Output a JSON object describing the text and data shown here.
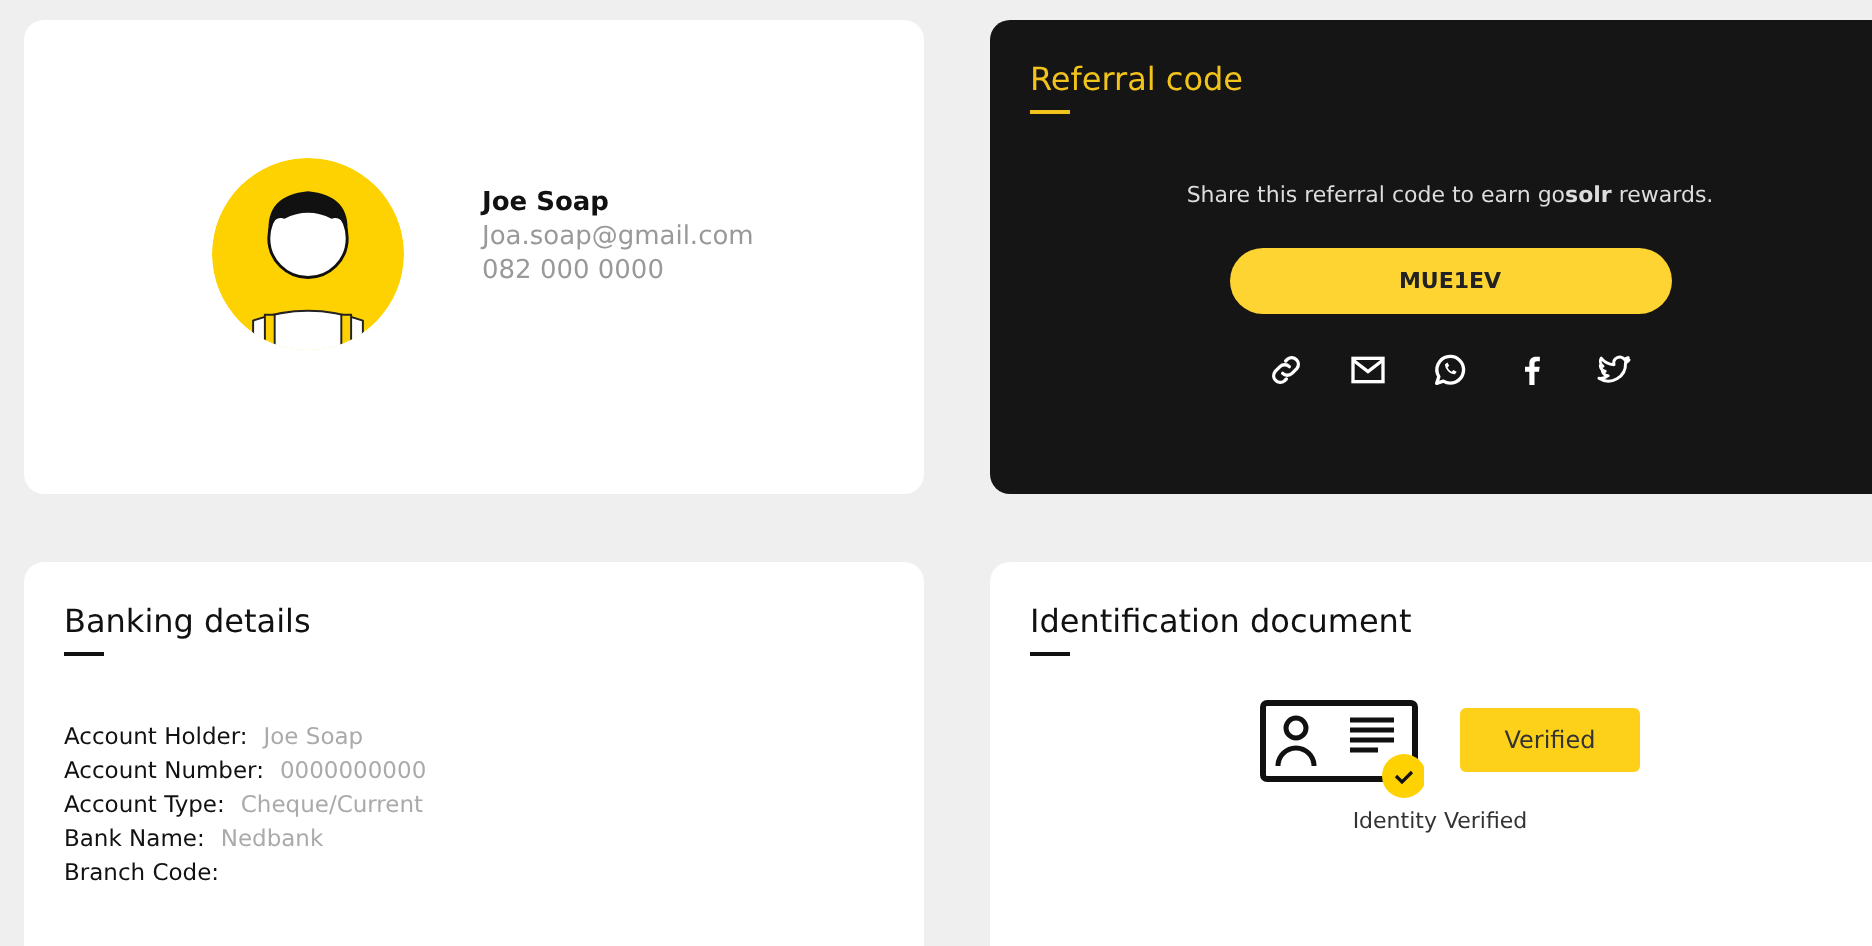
{
  "profile": {
    "name": "Joe Soap",
    "email": "Joa.soap@gmail.com",
    "phone": "082 000 0000"
  },
  "referral": {
    "title": "Referral code",
    "message": "Share this referral code to earn go**solr** rewards.",
    "code": "MUE1EV",
    "share": [
      {
        "kind": "link"
      },
      {
        "kind": "email"
      },
      {
        "kind": "whatsapp"
      },
      {
        "kind": "facebook"
      },
      {
        "kind": "twitter"
      }
    ]
  },
  "banking": {
    "title": "Banking details",
    "rows": [
      {
        "label": "Account Holder:",
        "value": "Joe Soap"
      },
      {
        "label": "Account Number:",
        "value": "0000000000"
      },
      {
        "label": "Account Type:",
        "value": "Cheque/Current"
      },
      {
        "label": "Bank Name:",
        "value": "Nedbank"
      },
      {
        "label": "Branch Code:"
      }
    ]
  },
  "identification": {
    "title": "Identification document",
    "badge": "Verified",
    "status": "Identity Verified",
    "verified": true
  }
}
